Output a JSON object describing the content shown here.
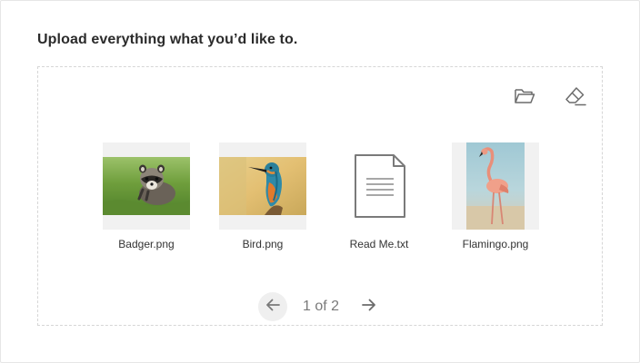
{
  "heading": "Upload everything what you’d like to.",
  "toolbar": {
    "open_icon": "folder-icon",
    "clear_icon": "eraser-icon"
  },
  "files": [
    {
      "name": "Badger.png",
      "kind": "image"
    },
    {
      "name": "Bird.png",
      "kind": "image"
    },
    {
      "name": "Read Me.txt",
      "kind": "text-document"
    },
    {
      "name": "Flamingo.png",
      "kind": "image"
    }
  ],
  "pagination": {
    "label": "1 of 2",
    "prev_icon": "arrow-left-icon",
    "next_icon": "arrow-right-icon"
  },
  "colors": {
    "icon": "#6b6b6b",
    "dropzone_border": "#d6d6d6",
    "thumb_background": "#f1f1f1"
  }
}
